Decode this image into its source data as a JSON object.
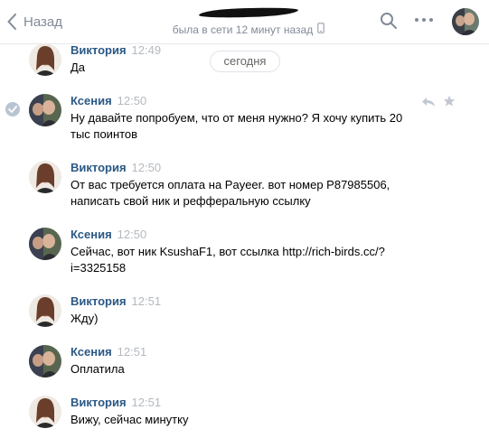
{
  "header": {
    "back_label": "Назад",
    "status": "была в сети 12 минут назад"
  },
  "date_divider": "сегодня",
  "messages": [
    {
      "author": "Виктория",
      "time": "12:49",
      "text": "Да",
      "avatar": "viktoria"
    },
    {
      "author": "Ксения",
      "time": "12:50",
      "text": "Ну давайте попробуем, что от меня нужно? Я хочу купить 20 тыс поинтов",
      "avatar": "ksenia",
      "selected": true
    },
    {
      "author": "Виктория",
      "time": "12:50",
      "text": "От вас требуется оплата на Payeer. вот номер P87985506, написать свой ник и рефферальную ссылку",
      "avatar": "viktoria"
    },
    {
      "author": "Ксения",
      "time": "12:50",
      "text": "Сейчас, вот ник KsushaF1, вот ссылка http://rich-birds.cc/?i=3325158",
      "avatar": "ksenia"
    },
    {
      "author": "Виктория",
      "time": "12:51",
      "text": "Жду)",
      "avatar": "viktoria"
    },
    {
      "author": "Ксения",
      "time": "12:51",
      "text": "Оплатила",
      "avatar": "ksenia"
    },
    {
      "author": "Виктория",
      "time": "12:51",
      "text": "Вижу, сейчас минутку",
      "avatar": "viktoria"
    }
  ],
  "icons": {
    "back": "chevron-left-icon",
    "search": "search-icon",
    "more": "more-dots-icon",
    "phone": "mobile-phone-icon",
    "reply": "reply-icon",
    "star": "star-icon",
    "check": "checkmark-icon"
  },
  "colors": {
    "link_blue": "#2a5885",
    "muted_gray": "#828a99",
    "selection_check": "#b9c4d3"
  }
}
